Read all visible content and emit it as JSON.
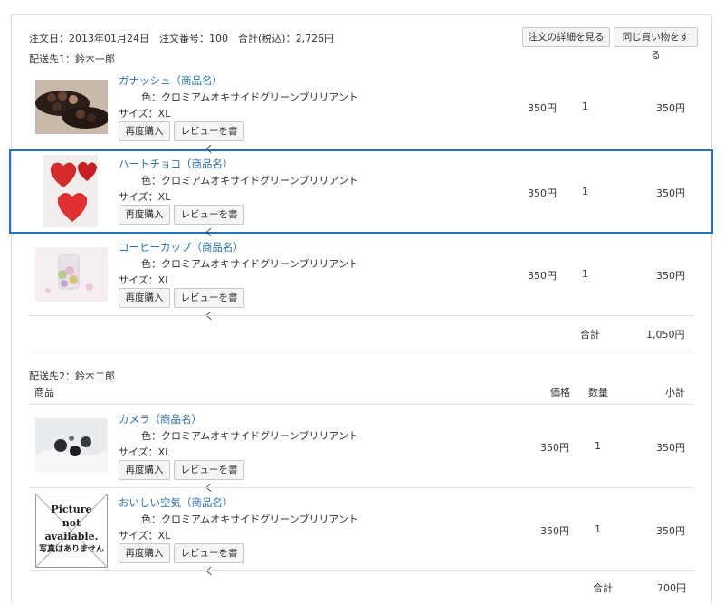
{
  "order": {
    "header": "注文日：2013年01月24日　注文番号：100　合計(税込)：2,726円",
    "detail_button": "注文の詳細を見る",
    "repeat_button": "同じ買い物をする"
  },
  "buttons": {
    "rebuy": "再度購入",
    "review": "レビューを書く"
  },
  "shipments": [
    {
      "label": "配送先1：鈴木一郎",
      "items": [
        {
          "name": "ガナッシュ（商品名）",
          "color": "色：クロミアムオキサイドグリーンブリリアント",
          "size": "サイズ：XL",
          "price": "350円",
          "qty": "1",
          "subtotal": "350円"
        },
        {
          "name": "ハートチョコ（商品名）",
          "color": "色：クロミアムオキサイドグリーンブリリアント",
          "size": "サイズ：XL",
          "price": "350円",
          "qty": "1",
          "subtotal": "350円"
        },
        {
          "name": "コーヒーカップ（商品名）",
          "color": "色：クロミアムオキサイドグリーンブリリアント",
          "size": "サイズ：XL",
          "price": "350円",
          "qty": "1",
          "subtotal": "350円"
        }
      ],
      "total_label": "合計",
      "total_value": "1,050円"
    },
    {
      "label": "配送先2：鈴木二郎",
      "columns": {
        "product": "商品",
        "price": "価格",
        "qty": "数量",
        "subtotal": "小計"
      },
      "items": [
        {
          "name": "カメラ（商品名）",
          "color": "色：クロミアムオキサイドグリーンブリリアント",
          "size": "サイズ：XL",
          "price": "350円",
          "qty": "1",
          "subtotal": "350円"
        },
        {
          "name": "おいしい空気（商品名）",
          "color": "色：クロミアムオキサイドグリーンブリリアント",
          "size": "サイズ：XL",
          "price": "350円",
          "qty": "1",
          "subtotal": "350円"
        }
      ],
      "total_label": "合計",
      "total_value": "700円"
    }
  ],
  "placeholder_image": {
    "line1": "Picture",
    "line2": "not",
    "line3": "available.",
    "line4": "写真はありません"
  },
  "colors": {
    "link": "#2a6fb0",
    "highlight": "#1e73c4"
  }
}
